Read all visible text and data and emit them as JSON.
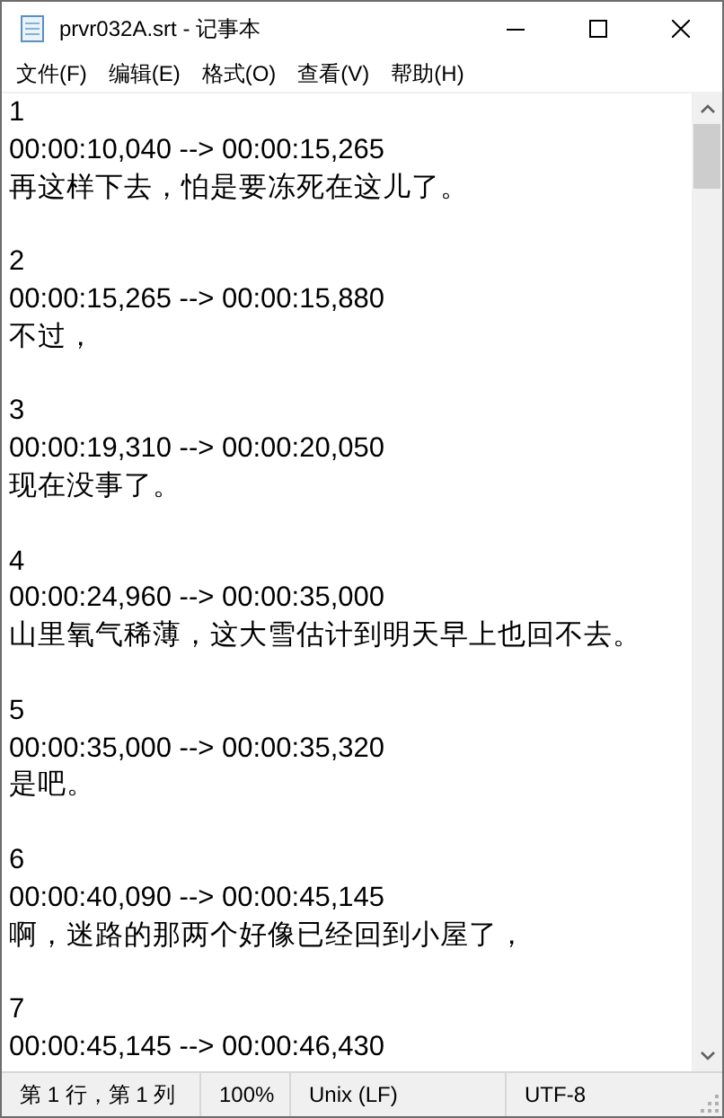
{
  "window": {
    "title": "prvr032A.srt - 记事本"
  },
  "menu": [
    "文件(F)",
    "编辑(E)",
    "格式(O)",
    "查看(V)",
    "帮助(H)"
  ],
  "entries": [
    {
      "index": "1",
      "time": "00:00:10,040 --> 00:00:15,265",
      "text": "再这样下去，怕是要冻死在这儿了。"
    },
    {
      "index": "2",
      "time": "00:00:15,265 --> 00:00:15,880",
      "text": "不过，"
    },
    {
      "index": "3",
      "time": "00:00:19,310 --> 00:00:20,050",
      "text": "现在没事了。"
    },
    {
      "index": "4",
      "time": "00:00:24,960 --> 00:00:35,000",
      "text": "山里氧气稀薄，这大雪估计到明天早上也回不去。"
    },
    {
      "index": "5",
      "time": "00:00:35,000 --> 00:00:35,320",
      "text": "是吧。"
    },
    {
      "index": "6",
      "time": "00:00:40,090 --> 00:00:45,145",
      "text": "啊，迷路的那两个好像已经回到小屋了，"
    },
    {
      "index": "7",
      "time": "00:00:45,145 --> 00:00:46,430"
    }
  ],
  "status_bar": [
    "第 1 行，第 1 列",
    "100%",
    "Unix (LF)",
    "UTF-8"
  ]
}
